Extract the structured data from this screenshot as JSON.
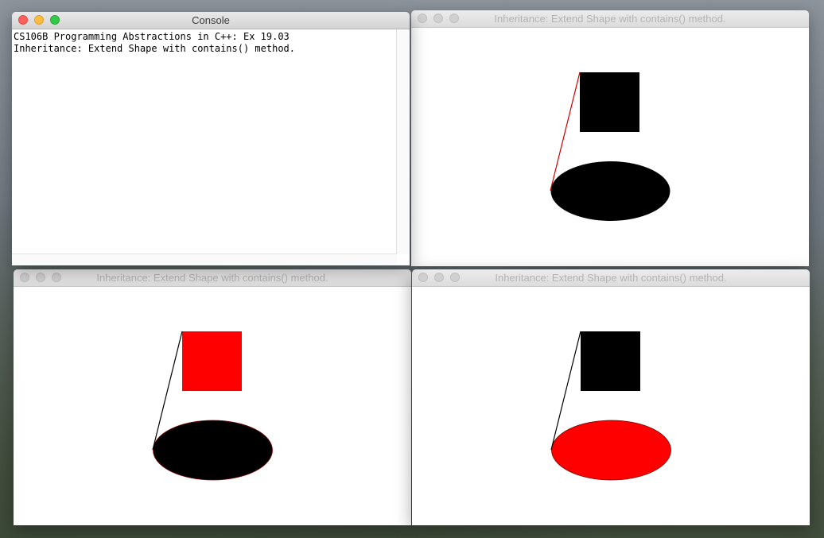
{
  "console": {
    "title": "Console",
    "lines": [
      "CS106B Programming Abstractions in C++: Ex 19.03",
      "Inheritance: Extend Shape with contains() method."
    ]
  },
  "graphics_windows": [
    {
      "title": "Inheritance: Extend Shape with contains() method.",
      "square_color": "#000000",
      "oval_color": "#000000",
      "line_color": "#cc0000"
    },
    {
      "title": "Inheritance: Extend Shape with contains() method.",
      "square_color": "#ff0000",
      "oval_color": "#000000",
      "line_color": "#000000"
    },
    {
      "title": "Inheritance: Extend Shape with contains() method.",
      "square_color": "#000000",
      "oval_color": "#ff0000",
      "line_color": "#000000"
    }
  ],
  "icons": {
    "close": "close-button",
    "minimize": "minimize-button",
    "zoom": "zoom-button"
  }
}
